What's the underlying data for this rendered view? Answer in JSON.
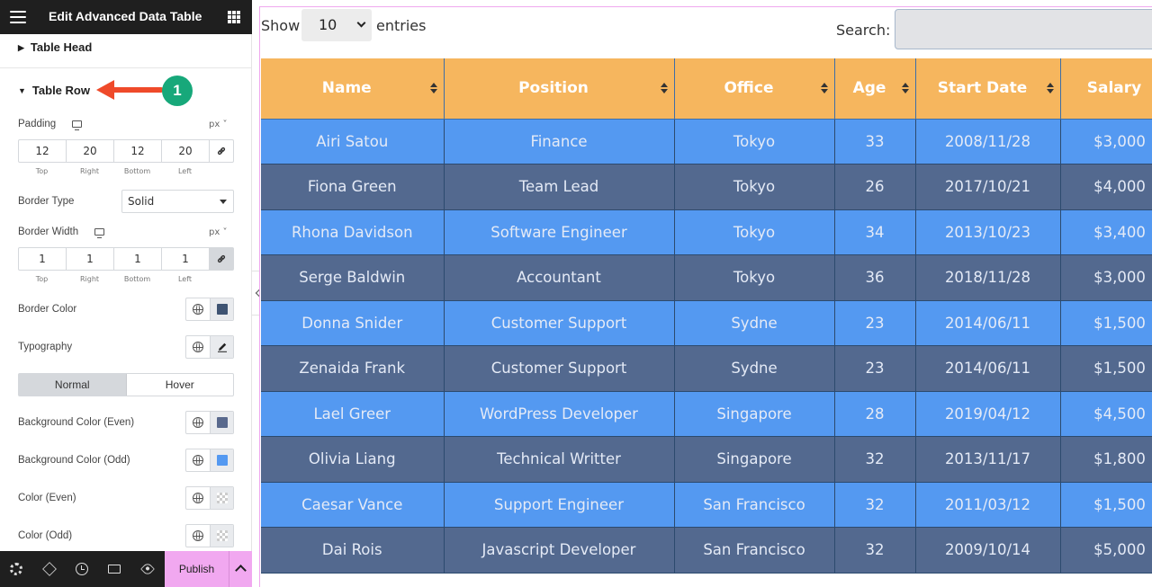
{
  "panel": {
    "title": "Edit Advanced Data Table",
    "sections": {
      "table_head": "Table Head",
      "table_row": "Table Row"
    },
    "annotation_badge": "1",
    "padding": {
      "label": "Padding",
      "unit": "px",
      "values": [
        "12",
        "20",
        "12",
        "20"
      ],
      "sides": [
        "Top",
        "Right",
        "Bottom",
        "Left"
      ]
    },
    "border_type": {
      "label": "Border Type",
      "value": "Solid"
    },
    "border_width": {
      "label": "Border Width",
      "unit": "px",
      "values": [
        "1",
        "1",
        "1",
        "1"
      ],
      "sides": [
        "Top",
        "Right",
        "Bottom",
        "Left"
      ]
    },
    "border_color": {
      "label": "Border Color",
      "swatch": "#3f5473"
    },
    "typography": {
      "label": "Typography"
    },
    "state_tabs": {
      "normal": "Normal",
      "hover": "Hover"
    },
    "bg_even": {
      "label": "Background Color (Even)",
      "swatch": "#59698d"
    },
    "bg_odd": {
      "label": "Background Color (Odd)",
      "swatch": "#5499f1"
    },
    "color_even": {
      "label": "Color (Even)"
    },
    "color_odd": {
      "label": "Color (Odd)"
    },
    "publish": "Publish"
  },
  "preview": {
    "show_label": "Show",
    "entries_value": "10",
    "entries_label": "entries",
    "search_label": "Search:",
    "search_value": "",
    "colors": {
      "header_bg": "#f6b65e",
      "row_odd": "#5499f1",
      "row_even": "#53698f"
    },
    "columns": [
      "Name",
      "Position",
      "Office",
      "Age",
      "Start Date",
      "Salary"
    ],
    "rows": [
      [
        "Airi Satou",
        "Finance",
        "Tokyo",
        "33",
        "2008/11/28",
        "$3,000"
      ],
      [
        "Fiona Green",
        "Team Lead",
        "Tokyo",
        "26",
        "2017/10/21",
        "$4,000"
      ],
      [
        "Rhona Davidson",
        "Software Engineer",
        "Tokyo",
        "34",
        "2013/10/23",
        "$3,400"
      ],
      [
        "Serge Baldwin",
        "Accountant",
        "Tokyo",
        "36",
        "2018/11/28",
        "$3,000"
      ],
      [
        "Donna Snider",
        "Customer Support",
        "Sydne",
        "23",
        "2014/06/11",
        "$1,500"
      ],
      [
        "Zenaida Frank",
        "Customer Support",
        "Sydne",
        "23",
        "2014/06/11",
        "$1,500"
      ],
      [
        "Lael Greer",
        "WordPress Developer",
        "Singapore",
        "28",
        "2019/04/12",
        "$4,500"
      ],
      [
        "Olivia Liang",
        "Technical Writter",
        "Singapore",
        "32",
        "2013/11/17",
        "$1,800"
      ],
      [
        "Caesar Vance",
        "Support Engineer",
        "San Francisco",
        "32",
        "2011/03/12",
        "$1,500"
      ],
      [
        "Dai Rois",
        "Javascript Developer",
        "San Francisco",
        "32",
        "2009/10/14",
        "$5,000"
      ]
    ]
  }
}
